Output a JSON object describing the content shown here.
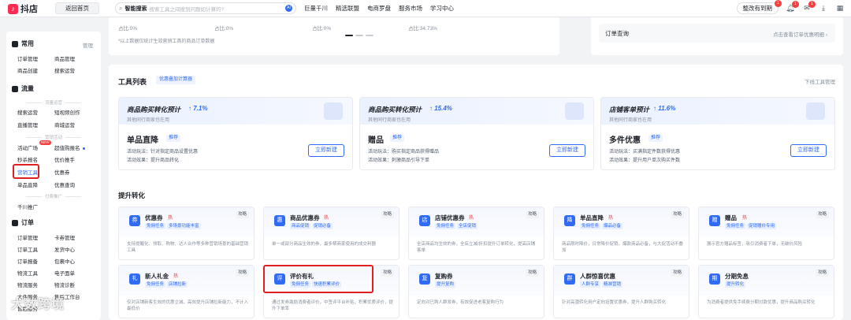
{
  "topbar": {
    "logo_text": "抖店",
    "home_button": "返回首页",
    "search_label": "智能搜索",
    "search_placeholder": "搜索工具之间搜到问题如计算的?",
    "search_ai": "AI",
    "nav": [
      "巨量千川",
      "精选联盟",
      "电商罗盘",
      "服务市场",
      "学习中心"
    ],
    "switch_button": "整改有到期",
    "switch_badge": "1",
    "bell_badge": "1",
    "chat_badge": "1"
  },
  "sidebar": {
    "common": {
      "title": "常用",
      "manage": "管理",
      "items": [
        "订单管理",
        "商品管理",
        "商品创建",
        "搜索运营"
      ]
    },
    "traffic": {
      "title": "流量",
      "cap_ops": "流量运营",
      "ops_items": [
        "搜索运营",
        "短视频创作",
        "直播管理",
        "商城运营"
      ],
      "cap_marketing": "营销活动",
      "mkt_items": [
        "活动广场",
        "超值购报名",
        "秒杀报名",
        "优价推手",
        "营销工具",
        "优惠券",
        "单品直降",
        "优惠查询"
      ],
      "hot_badge": "NEW",
      "cap_promo": "付费推广",
      "promo_items": [
        "千川推广"
      ]
    },
    "order": {
      "title": "订单",
      "items": [
        "订单管理",
        "卡券管理",
        "订单工具",
        "发货中心",
        "订单报备",
        "包裹中心",
        "物流工具",
        "电子面单",
        "物流服务",
        "物流诊断",
        "大件服务",
        "售后工作台",
        "售后服务"
      ]
    }
  },
  "top_summary": {
    "stats": [
      "占比:0%",
      "占比:0%",
      "占比:0%",
      "占比:34.73%"
    ],
    "note": "*以上数据仅统计生效营销工具的商品订单数据",
    "order_query": "订单查询",
    "order_link": "点击查看订单优惠明细 ›"
  },
  "tool_list": {
    "title": "工具列表",
    "calc": "优惠叠加计算器",
    "download": "下线工具管理",
    "big_cards": [
      {
        "band_title": "商品购买转化预计",
        "rate": "↑ 7.1%",
        "sub": "其他同行商家也在用",
        "name": "单品直降",
        "tag": "推荐",
        "play": "活动玩法：针对指定商品设置优惠",
        "effect": "活动效果：提升商品转化",
        "button": "立即新建"
      },
      {
        "band_title": "商品购买转化预计",
        "rate": "↑ 15.4%",
        "sub": "其他同行商家也在用",
        "name": "赠品",
        "tag": "推荐",
        "play": "活动玩法：购买指定商品获得赠品",
        "effect": "活动效果：刺激商品引导下单",
        "button": "立即新建"
      },
      {
        "band_title": "店铺客单预计",
        "rate": "↑ 11.6%",
        "sub": "其他同行商家也在用",
        "name": "多件优惠",
        "tag": "推荐",
        "play": "活动玩法：买满指定件数获得优惠",
        "effect": "活动效果：提升用户单次购买件数",
        "button": "立即新建"
      }
    ]
  },
  "boost": {
    "title": "提升转化",
    "guide": "攻略",
    "cards": [
      {
        "icon": "券",
        "name": "优惠券",
        "hot": "热",
        "tags": [
          "免佣任务",
          "多场景功能丰富"
        ],
        "desc": "支持提醒化、领取、购物、达人合作等多种营销场景的基础营销工具"
      },
      {
        "icon": "惠",
        "name": "商品优惠券",
        "hot": "热",
        "tags": [
          "商品促销",
          "促销必备"
        ],
        "desc": "单一或部分商品生效的券，最多帮商家使用的成交利器"
      },
      {
        "icon": "店",
        "name": "店铺优惠券",
        "hot": "热",
        "tags": [
          "免佣任务",
          "全店促销"
        ],
        "desc": "全店商品均生效的券，全店立减/折扣提升订单转化，提高店铺客单"
      },
      {
        "icon": "降",
        "name": "单品直降",
        "hot": "热",
        "tags": [
          "免佣任务",
          "爆品必备"
        ],
        "desc": "商品限时降价，日常降价促销，爆款商品必备，与大促活动不叠加"
      },
      {
        "icon": "赠",
        "name": "赠品",
        "hot": "热",
        "tags": [
          "免佣任务",
          "促销赠价专用"
        ],
        "desc": "展示官方赠品标签，吸引消费者下单，无破价风险"
      },
      {
        "icon": "礼",
        "name": "新人礼金",
        "hot": "热",
        "tags": [
          "免佣任务",
          "店铺拉新"
        ],
        "desc": "仅对店铺新客生效的优惠立减，高效提升店铺拉新能力，不计入最低价"
      },
      {
        "icon": "评",
        "name": "评价有礼",
        "hot": "",
        "tags": [
          "免佣任务",
          "快速积累评价"
        ],
        "desc": "通过发券激励消费者评价，中签评平台补贴，积累优质评价，提升下单率"
      },
      {
        "icon": "复",
        "name": "复购券",
        "hot": "",
        "tags": [
          "提升复购"
        ],
        "desc": "定向对已购人群发券，有效促进老客复购行为"
      },
      {
        "icon": "群",
        "name": "人群惊喜优惠",
        "hot": "",
        "tags": [
          "人群专享",
          "精准营销"
        ],
        "desc": "针对高潜转化用户定向设置优惠券，提升人群购买转化"
      },
      {
        "icon": "期",
        "name": "分期免息",
        "hot": "",
        "tags": [
          "提升转化"
        ],
        "desc": "为消费者提供免手续费分期付款优惠，提升商品购买转化"
      }
    ]
  },
  "watermark": "大数跨境",
  "colors": {
    "accent": "#2f6bf5",
    "highlight": "#e02020",
    "hot": "#f53f3f"
  }
}
